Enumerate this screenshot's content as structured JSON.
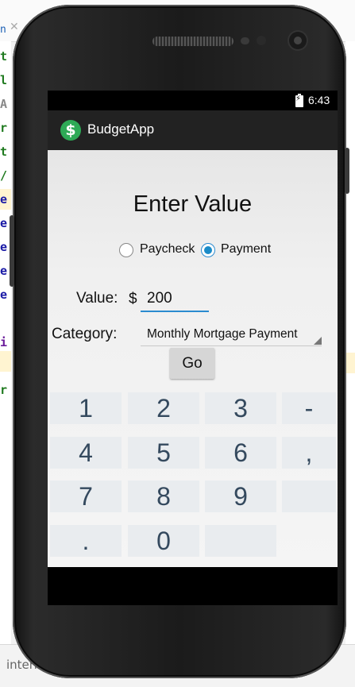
{
  "ide": {
    "code_chars": [
      "t",
      "l",
      "A",
      "r",
      "t",
      "/",
      "e",
      "e",
      "e",
      "e",
      "e",
      "i",
      "r"
    ],
    "bottom_text": "interr"
  },
  "status_bar": {
    "time": "6:43"
  },
  "app": {
    "title": "BudgetApp",
    "icon_glyph": "$",
    "icon_color": "#2eaa56"
  },
  "form": {
    "heading": "Enter Value",
    "radio_options": [
      {
        "label": "Paycheck",
        "checked": false
      },
      {
        "label": "Payment",
        "checked": true
      }
    ],
    "value_label": "Value:",
    "currency_symbol": "$",
    "value": "200",
    "category_label": "Category:",
    "category_selected": "Monthly Mortgage Payment",
    "go_label": "Go"
  },
  "keypad": {
    "rows": [
      [
        "1",
        "2",
        "3",
        "-"
      ],
      [
        "4",
        "5",
        "6",
        ","
      ],
      [
        "7",
        "8",
        "9",
        ""
      ],
      [
        ".",
        "0",
        ""
      ]
    ]
  },
  "colors": {
    "accent": "#1a8bc8",
    "action_bar": "#222222",
    "key_bg": "#e9ecef",
    "key_text": "#34495e"
  }
}
